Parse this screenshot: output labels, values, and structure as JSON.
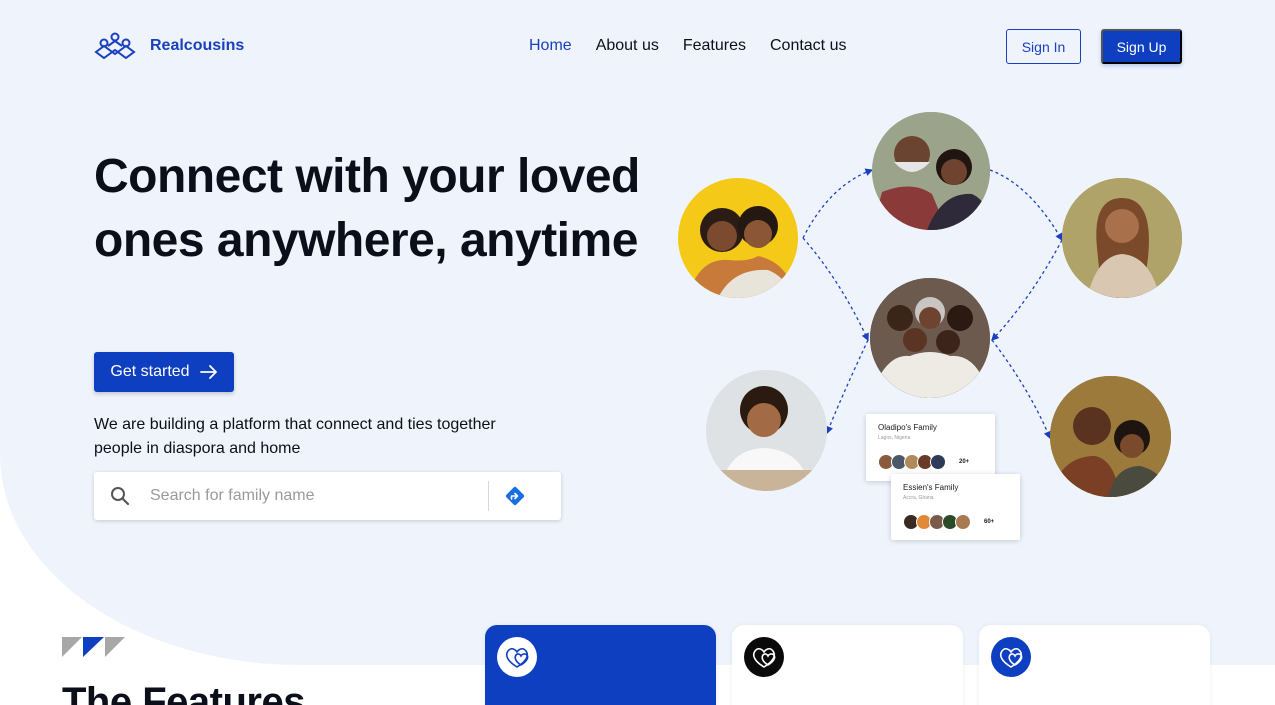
{
  "brand": {
    "name": "Realcousins",
    "accent": "#0d3fc0"
  },
  "nav": {
    "items": [
      {
        "label": "Home",
        "active": true
      },
      {
        "label": "About us",
        "active": false
      },
      {
        "label": "Features",
        "active": false
      },
      {
        "label": "Contact us",
        "active": false
      }
    ],
    "signin_label": "Sign In",
    "signup_label": "Sign Up"
  },
  "hero": {
    "headline": "Connect with your loved ones anywhere, anytime",
    "cta_label": "Get started",
    "description": "We are building a platform that connect and ties together people in diaspora and home",
    "search": {
      "placeholder": "Search for family name",
      "value": ""
    }
  },
  "family_cards": [
    {
      "name": "Oladipo's Family",
      "location": "Lagos, Nigeria",
      "count": "20+"
    },
    {
      "name": "Essien's Family",
      "location": "Accra, Ghana",
      "count": "60+"
    }
  ],
  "features": {
    "title": "The Features",
    "cards": [
      {
        "icon": "hearts-icon",
        "style": "primary"
      },
      {
        "icon": "hearts-icon",
        "style": "dark"
      },
      {
        "icon": "hearts-icon",
        "style": "blue"
      }
    ]
  }
}
